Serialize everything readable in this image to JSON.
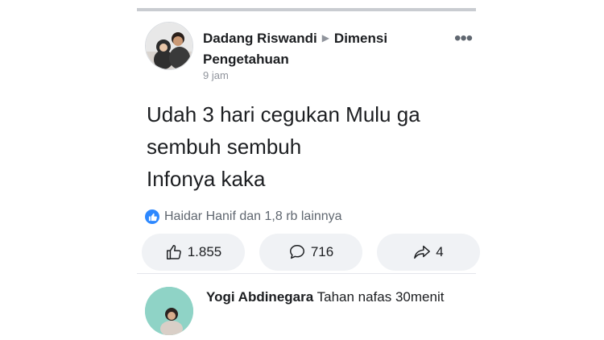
{
  "post": {
    "author": "Dadang Riswandi",
    "group": "Dimensi Pengetahuan",
    "time": "9 jam",
    "text_lines": [
      "Udah 3 hari cegukan Mulu ga",
      "sembuh sembuh",
      "Infonya kaka"
    ]
  },
  "reactions": {
    "summary": "Haidar Hanif dan 1,8 rb lainnya",
    "icon": "like-icon",
    "color": "#2d88ff"
  },
  "actions": {
    "likes": "1.855",
    "comments": "716",
    "shares": "4"
  },
  "comment": {
    "author": "Yogi Abdinegara",
    "text": "Tahan nafas 30menit"
  },
  "colors": {
    "divider": "#c9ccd1",
    "pill_bg": "#f0f2f5",
    "muted": "#90949c"
  }
}
